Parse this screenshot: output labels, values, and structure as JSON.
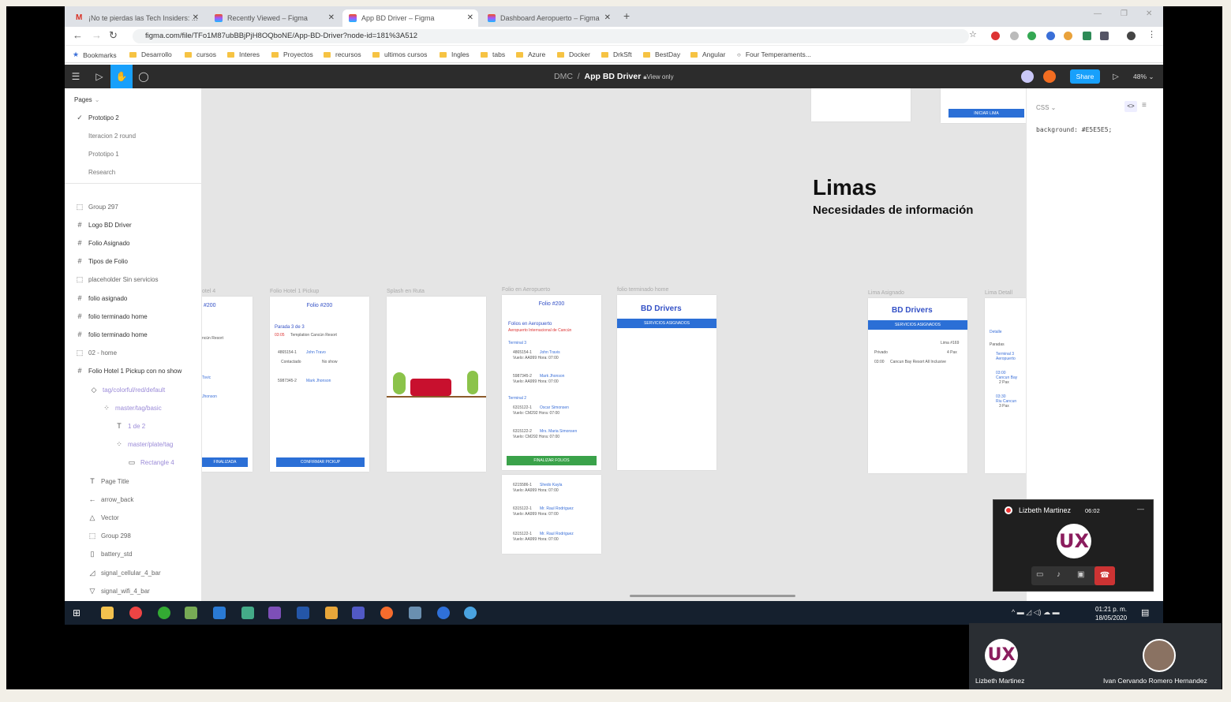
{
  "browser": {
    "tabs": [
      {
        "label": "¡No te pierdas las Tech Insiders: ...",
        "icon": "gmail-icon"
      },
      {
        "label": "Recently Viewed – Figma",
        "icon": "figma-icon"
      },
      {
        "label": "App BD Driver – Figma",
        "icon": "figma-icon"
      },
      {
        "label": "Dashboard Aeropuerto – Figma",
        "icon": "figma-icon"
      }
    ],
    "url": "figma.com/file/TFo1M87ubBBjPjH8OQboNE/App-BD-Driver?node-id=181%3A512",
    "bookmarks": [
      "Bookmarks",
      "Desarrollo",
      "cursos",
      "Interes",
      "Proyectos",
      "recursos",
      "ultimos cursos",
      "Ingles",
      "tabs",
      "Azure",
      "Docker",
      "DrkSft",
      "BestDay",
      "Angular",
      "Four Temperaments..."
    ]
  },
  "figma": {
    "team": "DMC",
    "file": "App BD Driver",
    "view_only": "View only",
    "share": "Share",
    "zoom": "48%",
    "pages_label": "Pages",
    "pages": [
      "Prototipo 2",
      "Iteracion 2 round",
      "Prototipo 1",
      "Research"
    ],
    "layers": [
      "Group 297",
      "Logo BD Driver",
      "Folio Asignado",
      "Tipos de Folio",
      "placeholder Sin servicios",
      "folio asignado",
      "folio terminado home",
      "folio terminado home",
      "02 - home",
      "Folio Hotel 1 Pickup con no show",
      "tag/colorful/red/default",
      "master/tag/basic",
      "1 de 2",
      "master/plate/tag",
      "Rectangle 4",
      "Page Title",
      "arrow_back",
      "Vector",
      "Group 298",
      "battery_std",
      "signal_cellular_4_bar",
      "signal_wifi_4_bar"
    ],
    "css_label": "CSS",
    "css_line": "background: #E5E5E5;"
  },
  "canvas": {
    "title": "Limas",
    "subtitle": "Necesidades de información",
    "frame_labels": [
      "otel 4",
      "Folio Hotel 1 Pickup",
      "Splash en Ruta",
      "Folio en Aeropuerto",
      "folio terminado home",
      "Lima Asignado",
      "Lima Detall"
    ],
    "iniciar": "INICIAR LIMA",
    "f1": {
      "head": "#200",
      "l1": "ncún Resort",
      "l2": "Tsvic",
      "l3": "Jhonson",
      "btn": "FINALIZADA"
    },
    "f2": {
      "head": "Folio #200",
      "title": "Parada 3 de 3",
      "time": "03:05",
      "hotel": "Templation Cancún Resort",
      "p1": "4865154-1",
      "n1": "John Travo",
      "p2": "5987345-2",
      "n2": "Mark Jhonson",
      "c": "Contactado",
      "ns": "No show",
      "btn": "CONFIRMAR PICKUP"
    },
    "f4": {
      "head": "Folio #200",
      "title": "Folios en Aeropuerto",
      "sub": "Aeropuerto Internacional de Cancún",
      "t3": "Terminal 3",
      "t2": "Terminal 2",
      "rows": [
        [
          "4865154-1",
          "John Travis",
          "Vuelo: AA999 Hora: 07:00"
        ],
        [
          "5987345-2",
          "Mark Jhonson",
          "Vuelo: AA999 Hora: 07:00"
        ],
        [
          "6315122-1",
          "Oscar Simonsen",
          "Vuelo: CM292 Hora: 07:00"
        ],
        [
          "6315122-2",
          "Mrs. Maria Simonsen",
          "Vuelo: CM292 Hora: 07:00"
        ]
      ],
      "btn": "FINALIZAR FOLIOS",
      "rows2": [
        [
          "6215586-1",
          "Shedo Kayla",
          "Vuelo: AA999 Hora: 07:00"
        ],
        [
          "6315122-1",
          "Mr. Raul Rodriguez",
          "Vuelo: AA999 Hora: 07:00"
        ],
        [
          "6315122-1",
          "Mr. Raul Rodriguez",
          "Vuelo: AA999 Hora: 07:00"
        ]
      ]
    },
    "f5": {
      "logo": "BD Drivers",
      "bar": "SERVICIOS ASIGNADOS"
    },
    "f6": {
      "logo": "BD Drivers",
      "bar": "SERVICIOS ASIGNADOS",
      "lima": "Lima #169",
      "priv": "Privado",
      "pax": "4 Pax",
      "time": "03:00",
      "hotel": "Cancun Bay Resort All Inclusive"
    },
    "f7": {
      "detalle": "Detalle",
      "paradas": "Paradas",
      "t3": "Terminal 3",
      "aero": "Aeropuerto",
      "s1": "03:00",
      "h1": "Cancun Bay",
      "p2": "2 Pax",
      "s2": "03:30",
      "h2": "Riu Cancun",
      "p3": "3 Pax"
    }
  },
  "call": {
    "name": "Lizbeth Martinez",
    "time": "06:02",
    "logo": "UX"
  },
  "participants": [
    "Lizbeth Martinez",
    "Ivan Cervando Romero Hernandez"
  ],
  "clock": {
    "time": "01:21 p. m.",
    "date": "18/05/2020"
  }
}
